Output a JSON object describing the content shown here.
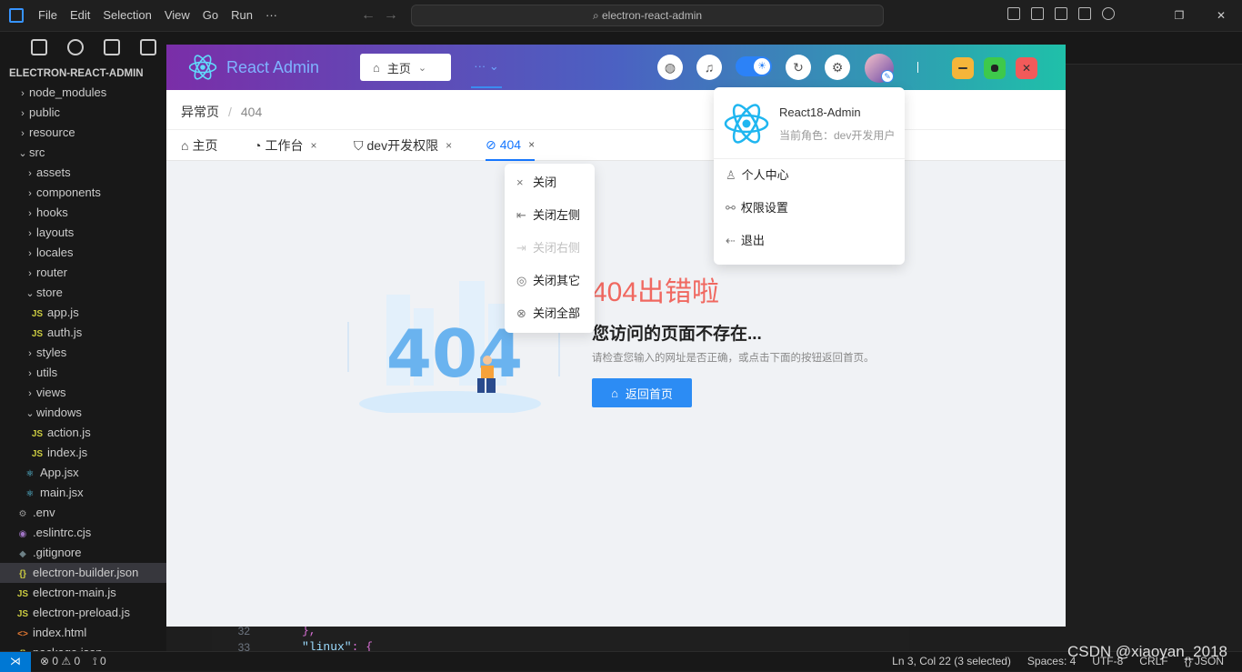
{
  "vscode": {
    "menu": [
      "File",
      "Edit",
      "Selection",
      "View",
      "Go",
      "Run",
      "···"
    ],
    "search_text": "electron-react-admin",
    "explorer_title": "ELECTRON-REACT-ADMIN",
    "tree": [
      {
        "label": "node_modules",
        "kind": "folder",
        "depth": 0,
        "open": false
      },
      {
        "label": "public",
        "kind": "folder",
        "depth": 0,
        "open": false
      },
      {
        "label": "resource",
        "kind": "folder",
        "depth": 0,
        "open": false
      },
      {
        "label": "src",
        "kind": "folder",
        "depth": 0,
        "open": true
      },
      {
        "label": "assets",
        "kind": "folder",
        "depth": 1,
        "open": false
      },
      {
        "label": "components",
        "kind": "folder",
        "depth": 1,
        "open": false
      },
      {
        "label": "hooks",
        "kind": "folder",
        "depth": 1,
        "open": false
      },
      {
        "label": "layouts",
        "kind": "folder",
        "depth": 1,
        "open": false
      },
      {
        "label": "locales",
        "kind": "folder",
        "depth": 1,
        "open": false
      },
      {
        "label": "router",
        "kind": "folder",
        "depth": 1,
        "open": false
      },
      {
        "label": "store",
        "kind": "folder",
        "depth": 1,
        "open": true
      },
      {
        "label": "app.js",
        "kind": "js",
        "depth": 2
      },
      {
        "label": "auth.js",
        "kind": "js",
        "depth": 2
      },
      {
        "label": "styles",
        "kind": "folder",
        "depth": 1,
        "open": false
      },
      {
        "label": "utils",
        "kind": "folder",
        "depth": 1,
        "open": false
      },
      {
        "label": "views",
        "kind": "folder",
        "depth": 1,
        "open": false
      },
      {
        "label": "windows",
        "kind": "folder",
        "depth": 1,
        "open": true
      },
      {
        "label": "action.js",
        "kind": "js",
        "depth": 2
      },
      {
        "label": "index.js",
        "kind": "js",
        "depth": 2
      },
      {
        "label": "App.jsx",
        "kind": "jsx",
        "depth": 1
      },
      {
        "label": "main.jsx",
        "kind": "jsx",
        "depth": 1
      },
      {
        "label": ".env",
        "kind": "gear",
        "depth": 0
      },
      {
        "label": ".eslintrc.cjs",
        "kind": "eslint",
        "depth": 0
      },
      {
        "label": ".gitignore",
        "kind": "git",
        "depth": 0
      },
      {
        "label": "electron-builder.json",
        "kind": "json",
        "depth": 0,
        "selected": true
      },
      {
        "label": "electron-main.js",
        "kind": "js",
        "depth": 0
      },
      {
        "label": "electron-preload.js",
        "kind": "js",
        "depth": 0
      },
      {
        "label": "index.html",
        "kind": "html",
        "depth": 0
      },
      {
        "label": "package.json",
        "kind": "json",
        "depth": 0
      }
    ],
    "gutter": [
      "32",
      "33"
    ],
    "code_line1": "},",
    "code_line2_key": "\"linux\"",
    "code_line2_rest": ": {",
    "status": {
      "errors": "⊗ 0 ⚠ 0",
      "ports": "⟟ 0",
      "cursor": "Ln 3, Col 22 (3 selected)",
      "spaces": "Spaces: 4",
      "encoding": "UTF-8",
      "eol": "CRLF",
      "language": "{} JSON"
    },
    "watermark": "CSDN @xiaoyan_2018"
  },
  "app": {
    "title": "React Admin",
    "home_select": "主页",
    "more": "···",
    "breadcrumb": [
      "异常页",
      "404"
    ],
    "tabs": [
      {
        "icon": "⌂",
        "label": "主页",
        "closable": false
      },
      {
        "icon": "◔",
        "label": "工作台",
        "closable": true
      },
      {
        "icon": "⛉",
        "label": "dev开发权限",
        "closable": true
      },
      {
        "icon": "⊘",
        "label": "404",
        "closable": true,
        "active": true
      }
    ],
    "tab_close": "×",
    "context_menu": [
      {
        "icon": "×",
        "label": "关闭",
        "disabled": false
      },
      {
        "icon": "⇤",
        "label": "关闭左侧",
        "disabled": false
      },
      {
        "icon": "⇥",
        "label": "关闭右侧",
        "disabled": true
      },
      {
        "icon": "◎",
        "label": "关闭其它",
        "disabled": false
      },
      {
        "icon": "⊗",
        "label": "关闭全部",
        "disabled": false
      }
    ],
    "user": {
      "name": "React18-Admin",
      "role": "当前角色：dev开发用户",
      "menu": [
        {
          "icon": "♙",
          "label": "个人中心"
        },
        {
          "icon": "⚯",
          "label": "权限设置"
        },
        {
          "icon": "⇠",
          "label": "退出"
        }
      ]
    },
    "error": {
      "big_number": "404",
      "title": "404出错啦",
      "subtitle": "您访问的页面不存在...",
      "hint": "请检查您输入的网址是否正确，或点击下面的按钮返回首页。",
      "back_button": "返回首页"
    },
    "colors": {
      "primary": "#1677ff",
      "error": "#f06860"
    }
  }
}
